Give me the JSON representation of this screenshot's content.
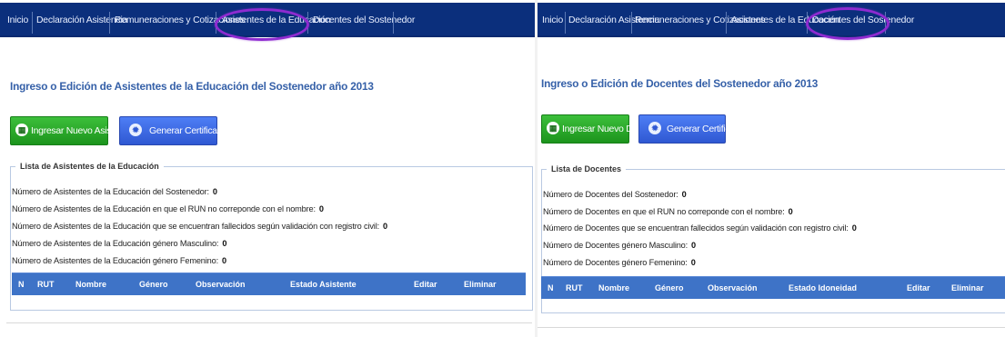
{
  "left": {
    "nav": [
      "Inicio",
      "Declaración Asistencia",
      "Remuneraciones y Cotizaciones",
      "Asistentes de la Educación",
      "Docentes del Sostenedor"
    ],
    "title": "Ingreso o Edición de Asistentes de la Educación del Sostenedor año 2013",
    "buttons": {
      "new": "Ingresar Nuevo Asistente",
      "cert": "Generar Certificado"
    },
    "legend": "Lista de Asistentes de la Educación",
    "stats": [
      {
        "label": "Número de Asistentes de la Educación del Sostenedor:",
        "value": "0"
      },
      {
        "label": "Número de Asistentes de la Educación en que el RUN no correponde con el nombre:",
        "value": "0"
      },
      {
        "label": "Número de Asistentes de la Educación que se encuentran fallecidos según validación con registro civil:",
        "value": "0"
      },
      {
        "label": "Número de Asistentes de la Educación género Masculino:",
        "value": "0"
      },
      {
        "label": "Número de Asistentes de la Educación género Femenino:",
        "value": "0"
      }
    ],
    "columns": [
      "N",
      "RUT",
      "Nombre",
      "Género",
      "Observación",
      "Estado Asistente",
      "Editar",
      "Eliminar"
    ]
  },
  "right": {
    "nav": [
      "Inicio",
      "Declaración Asistencia",
      "Remuneraciones y Cotizaciones",
      "Asistentes de la Educación",
      "Docentes del Sostenedor"
    ],
    "title": "Ingreso o Edición de Docentes del Sostenedor año 2013",
    "buttons": {
      "new": "Ingresar Nuevo Docente",
      "cert": "Generar Certificado"
    },
    "legend": "Lista de Docentes",
    "stats": [
      {
        "label": "Número de Docentes del Sostenedor:",
        "value": "0"
      },
      {
        "label": "Número de Docentes en que el RUN no correponde con el nombre:",
        "value": "0"
      },
      {
        "label": "Número de Docentes que se encuentran fallecidos según validación con registro civil:",
        "value": "0"
      },
      {
        "label": "Número de Docentes género Masculino:",
        "value": "0"
      },
      {
        "label": "Número de Docentes género Femenino:",
        "value": "0"
      }
    ],
    "columns": [
      "N",
      "RUT",
      "Nombre",
      "Género",
      "Observación",
      "Estado Idoneidad",
      "Editar",
      "Eliminar"
    ]
  },
  "colors": {
    "nav": "#0b2f7c",
    "title": "#3560a8",
    "table_header": "#3e73c7",
    "highlight": "#8e2bd0",
    "btn_green": "#2aa82a",
    "btn_blue": "#3a66e0"
  },
  "icons": {
    "new_button": "save-icon",
    "cert_button": "gear-icon"
  }
}
